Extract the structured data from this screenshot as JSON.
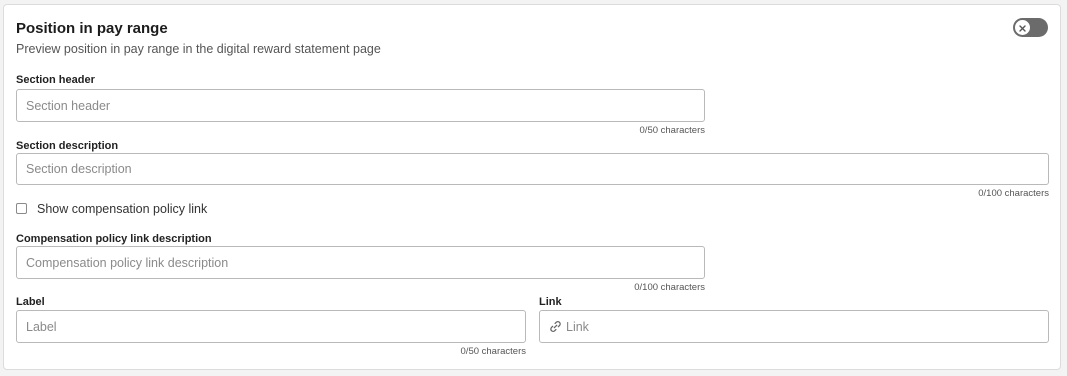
{
  "section": {
    "title": "Position in pay range",
    "subtitle": "Preview position in pay range in the digital reward statement page"
  },
  "toggle": {
    "state": "off",
    "icon": "close-icon"
  },
  "fields": {
    "section_header": {
      "label": "Section header",
      "placeholder": "Section header",
      "value": "",
      "counter": "0/50 characters"
    },
    "section_description": {
      "label": "Section description",
      "placeholder": "Section description",
      "value": "",
      "counter": "0/100 characters"
    },
    "policy_checkbox": {
      "label": "Show compensation policy link",
      "checked": false
    },
    "policy_link_description": {
      "label": "Compensation policy link description",
      "placeholder": "Compensation policy link description",
      "value": "",
      "counter": "0/100 characters"
    },
    "link_label": {
      "label": "Label",
      "placeholder": "Label",
      "value": "",
      "counter": "0/50 characters"
    },
    "link_url": {
      "label": "Link",
      "placeholder": "Link",
      "value": "",
      "icon": "link-icon"
    }
  }
}
